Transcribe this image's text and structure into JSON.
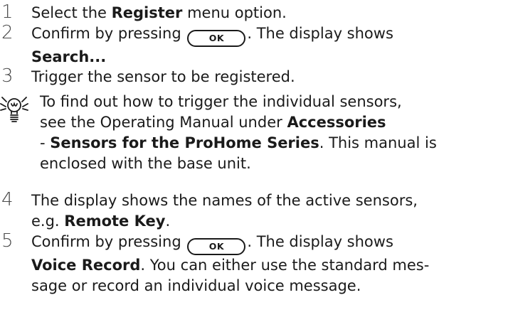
{
  "steps": [
    {
      "num": "1",
      "pre": "Select the ",
      "bold": "Register",
      "post": " menu option."
    },
    {
      "num": "2",
      "pre": "Confirm by pressing ",
      "button": "OK",
      "mid": ". The display shows",
      "bold2": "Search..."
    },
    {
      "num": "3",
      "text": "Trigger the sensor to be registered."
    },
    {
      "num": "4",
      "line1": "The display shows the names of the active sensors,",
      "pre2": "e.g. ",
      "bold": "Remote Key",
      "post": "."
    },
    {
      "num": "5",
      "pre": "Confirm by pressing ",
      "button": "OK",
      "mid": ". The display shows",
      "bold2": "Voice Record",
      "post2": ". You can either use the standard mes-",
      "line3": "sage or record an individual voice message."
    }
  ],
  "note": {
    "icon": "lightbulb-tip-icon",
    "line1": "To find out how to trigger the individual sensors,",
    "pre2": "see the Operating Manual under ",
    "bold2": "Accessories",
    "pre3": "- ",
    "bold3": "Sensors for the ProHome Series",
    "post3": ". This manual is",
    "line4": "enclosed with the base unit."
  }
}
